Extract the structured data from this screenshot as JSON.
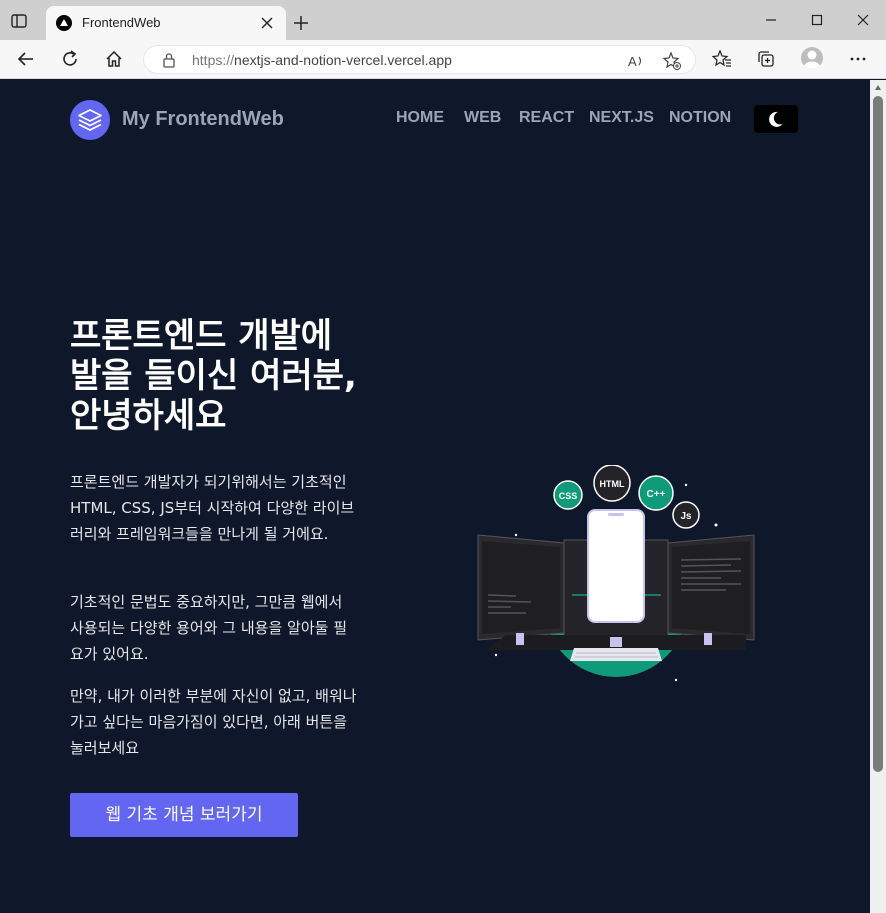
{
  "browser": {
    "tab_title": "FrontendWeb",
    "url_prefix": "https://",
    "url_host": "nextjs-and-notion-vercel.vercel.app"
  },
  "site": {
    "logo_text": "My FrontendWeb",
    "nav": [
      "HOME",
      "WEB",
      "REACT",
      "NEXT.JS",
      "NOTION"
    ]
  },
  "hero": {
    "title": "프론트엔드 개발에 발을 들이신 여러분, 안녕하세요",
    "paragraphs": [
      "프론트엔드 개발자가 되기위해서는 기초적인 HTML, CSS, JS부터 시작하여 다양한 라이브러리와 프레임워크들을 만나게 될 거에요.",
      "기초적인 문법도 중요하지만, 그만큼 웹에서 사용되는 다양한 용어와 그 내용을 알아둘 필요가 있어요.",
      "만약, 내가 이러한 부분에 자신이 없고, 배워나가고 싶다는 마음가짐이 있다면, 아래 버튼을 눌러보세요"
    ],
    "cta_label": "웹 기초 개념 보러가기"
  },
  "illustration": {
    "badges": [
      "CSS",
      "HTML",
      "C++",
      "Js"
    ]
  },
  "colors": {
    "page_bg": "#0f172a",
    "accent": "#6366f1",
    "nav_text": "#9aa6b8",
    "teal": "#0d9b7a"
  }
}
